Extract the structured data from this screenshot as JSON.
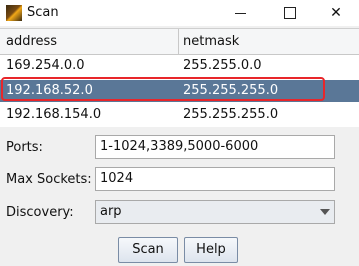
{
  "window": {
    "title": "Scan"
  },
  "table": {
    "columns": [
      "address",
      "netmask"
    ],
    "rows": [
      {
        "address": "169.254.0.0",
        "netmask": "255.255.0.0"
      },
      {
        "address": "192.168.52.0",
        "netmask": "255.255.255.0",
        "selected": true
      },
      {
        "address": "192.168.154.0",
        "netmask": "255.255.255.0"
      }
    ]
  },
  "form": {
    "ports_label": "Ports:",
    "ports_value": "1-1024,3389,5000-6000",
    "sockets_label": "Max Sockets:",
    "sockets_value": "1024",
    "discovery_label": "Discovery:",
    "discovery_value": "arp"
  },
  "buttons": {
    "scan": "Scan",
    "help": "Help"
  },
  "colors": {
    "selection": "#5a7797",
    "highlight": "#e8262a"
  }
}
